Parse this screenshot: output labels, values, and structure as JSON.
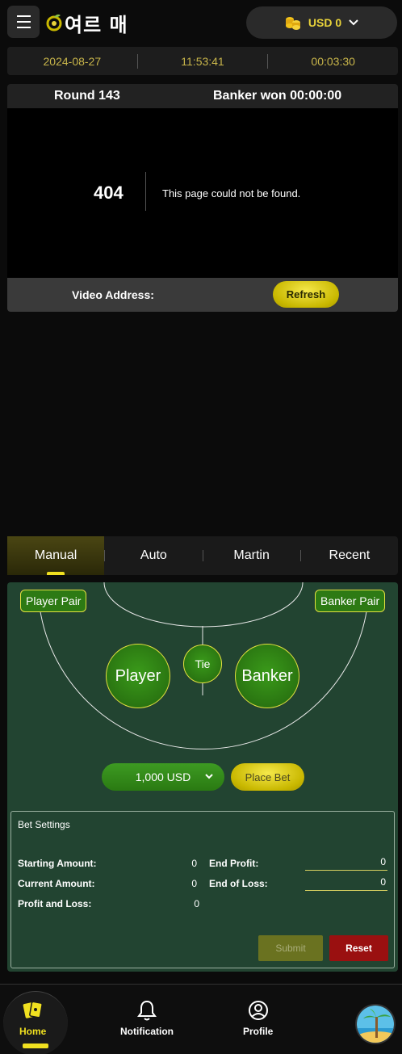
{
  "header": {
    "logo_text": "여르 매",
    "currency_label": "USD 0"
  },
  "timebar": {
    "date": "2024-08-27",
    "time": "11:53:41",
    "countdown": "00:03:30"
  },
  "video": {
    "round_label": "Round 143",
    "result_label": "Banker won 00:00:00",
    "error_code": "404",
    "error_message": "This page could not be found.",
    "address_label": "Video Address:",
    "refresh_label": "Refresh"
  },
  "tabs": [
    {
      "label": "Manual",
      "active": true
    },
    {
      "label": "Auto",
      "active": false
    },
    {
      "label": "Martin",
      "active": false
    },
    {
      "label": "Recent",
      "active": false
    }
  ],
  "table": {
    "player_pair": "Player Pair",
    "banker_pair": "Banker Pair",
    "player": "Player",
    "tie": "Tie",
    "banker": "Banker",
    "bet_amount": "1,000 USD",
    "place_bet": "Place Bet"
  },
  "settings": {
    "title": "Bet Settings",
    "starting_amount_label": "Starting Amount:",
    "starting_amount": "0",
    "current_amount_label": "Current Amount:",
    "current_amount": "0",
    "profit_loss_label": "Profit and Loss:",
    "profit_loss": "0",
    "end_profit_label": "End Profit:",
    "end_profit": "0",
    "end_loss_label": "End of Loss:",
    "end_loss": "0",
    "submit_label": "Submit",
    "reset_label": "Reset"
  },
  "nav": {
    "home": "Home",
    "notification": "Notification",
    "profile": "Profile"
  },
  "colors": {
    "accent": "#f0e020",
    "table_green": "#224431",
    "reset_red": "#9a1010"
  }
}
